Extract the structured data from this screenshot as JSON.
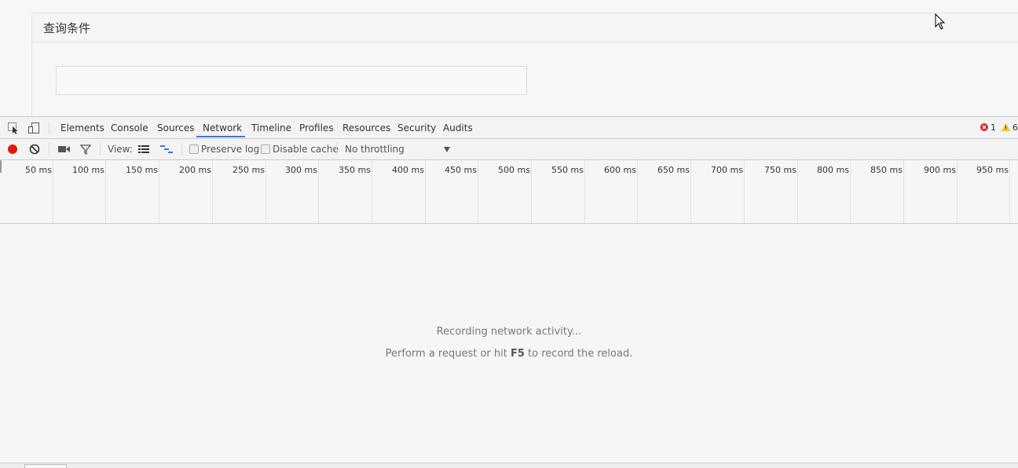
{
  "page": {
    "panel_title": "查询条件",
    "input_value": ""
  },
  "devtools": {
    "tabs": [
      {
        "label": "Elements",
        "active": false
      },
      {
        "label": "Console",
        "active": false
      },
      {
        "label": "Sources",
        "active": false
      },
      {
        "label": "Network",
        "active": true
      },
      {
        "label": "Timeline",
        "active": false
      },
      {
        "label": "Profiles",
        "active": false
      },
      {
        "label": "Resources",
        "active": false
      },
      {
        "label": "Security",
        "active": false
      },
      {
        "label": "Audits",
        "active": false
      }
    ],
    "error_count": "1",
    "warning_count": "6",
    "toolbar": {
      "view_label": "View:",
      "preserve_log": "Preserve log",
      "disable_cache": "Disable cache",
      "throttling": "No throttling"
    },
    "timeline_ticks": [
      "50 ms",
      "100 ms",
      "150 ms",
      "200 ms",
      "250 ms",
      "300 ms",
      "350 ms",
      "400 ms",
      "450 ms",
      "500 ms",
      "550 ms",
      "600 ms",
      "650 ms",
      "700 ms",
      "750 ms",
      "800 ms",
      "850 ms",
      "900 ms",
      "950 ms"
    ],
    "empty_state": {
      "line1": "Recording network activity...",
      "line2_pre": "Perform a request or hit ",
      "line2_key": "F5",
      "line2_post": " to record the reload."
    },
    "colors": {
      "record": "#e3190f",
      "accent": "#3879d9",
      "error": "#d7262a",
      "warning": "#f0c419"
    }
  }
}
